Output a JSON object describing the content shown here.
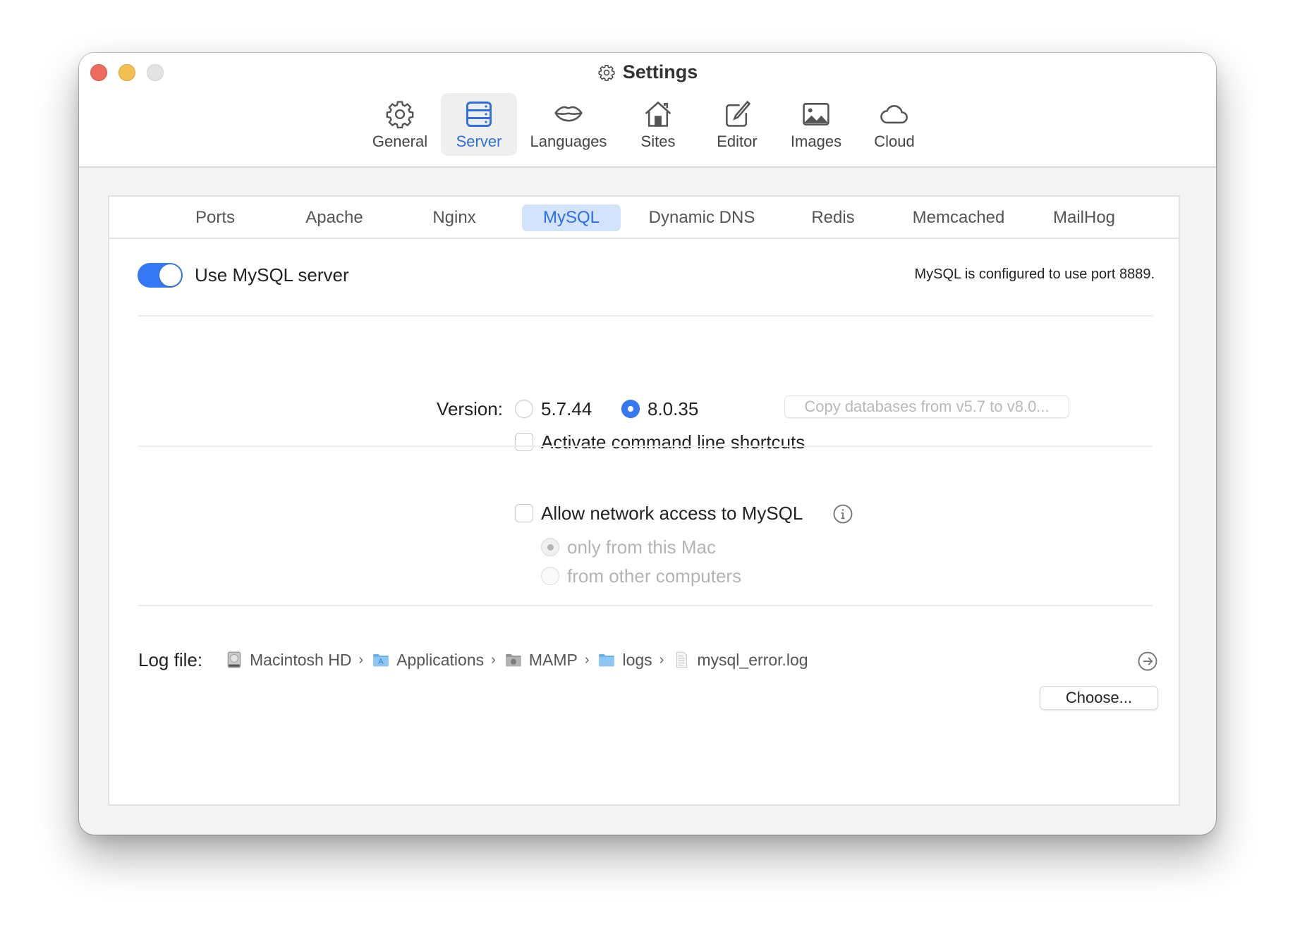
{
  "window": {
    "title": "Settings",
    "title_icon": "gear-icon"
  },
  "toolbar": {
    "items": [
      {
        "label": "General",
        "icon": "gear-icon",
        "active": false
      },
      {
        "label": "Server",
        "icon": "server-icon",
        "active": true
      },
      {
        "label": "Languages",
        "icon": "lips-icon",
        "active": false
      },
      {
        "label": "Sites",
        "icon": "house-icon",
        "active": false
      },
      {
        "label": "Editor",
        "icon": "edit-icon",
        "active": false
      },
      {
        "label": "Images",
        "icon": "image-icon",
        "active": false
      },
      {
        "label": "Cloud",
        "icon": "cloud-icon",
        "active": false
      }
    ]
  },
  "subtabs": {
    "items": [
      "Ports",
      "Apache",
      "Nginx",
      "MySQL",
      "Dynamic DNS",
      "Redis",
      "Memcached",
      "MailHog"
    ],
    "active": "MySQL"
  },
  "mysql": {
    "use_server_label": "Use MySQL server",
    "use_server_on": true,
    "port_note": "MySQL is configured to use port 8889.",
    "version_label": "Version:",
    "versions": [
      {
        "label": "5.7.44",
        "selected": false
      },
      {
        "label": "8.0.35",
        "selected": true
      }
    ],
    "copy_button_label": "Copy databases from v5.7 to v8.0...",
    "copy_button_enabled": false,
    "cli_shortcuts_label": "Activate command line shortcuts",
    "cli_shortcuts_checked": false,
    "network_access_label": "Allow network access to MySQL",
    "network_access_checked": false,
    "network_options": [
      {
        "label": "only from this Mac",
        "selected": true,
        "enabled": false
      },
      {
        "label": "from other computers",
        "selected": false,
        "enabled": false
      }
    ],
    "log_file_label": "Log file:",
    "log_path": [
      {
        "label": "Macintosh HD",
        "icon": "hard-drive-icon"
      },
      {
        "label": "Applications",
        "icon": "applications-folder-icon"
      },
      {
        "label": "MAMP",
        "icon": "mamp-folder-icon"
      },
      {
        "label": "logs",
        "icon": "folder-icon"
      },
      {
        "label": "mysql_error.log",
        "icon": "document-icon"
      }
    ],
    "choose_button_label": "Choose..."
  },
  "colors": {
    "accent": "#3478f6",
    "accent_text": "#2f6fe4",
    "active_tab_bg": "#d3e3fc",
    "close": "#ec6a5e",
    "minimize": "#f4bf4f",
    "zoom": "#e3e3e3"
  }
}
